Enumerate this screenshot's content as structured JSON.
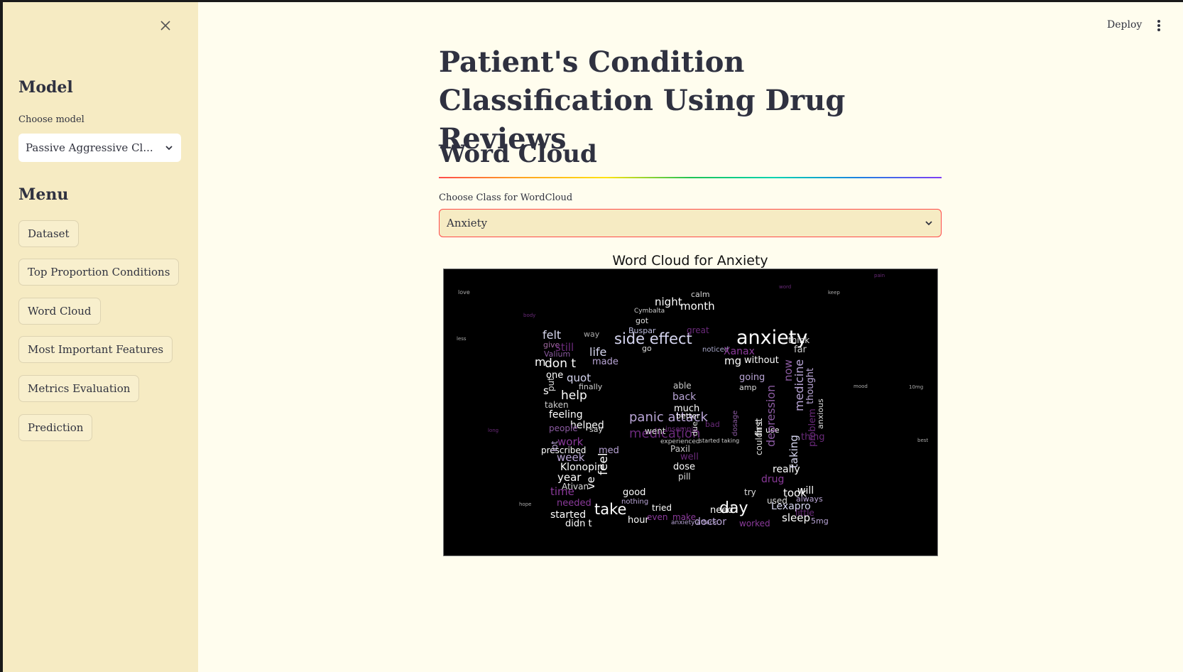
{
  "sidebar": {
    "close_icon": "close-icon",
    "model_heading": "Model",
    "model_label": "Choose model",
    "model_value": "Passive Aggressive Cl...",
    "menu_heading": "Menu",
    "menu_items": [
      "Dataset",
      "Top Proportion Conditions",
      "Word Cloud",
      "Most Important Features",
      "Metrics Evaluation",
      "Prediction"
    ]
  },
  "topbar": {
    "deploy_label": "Deploy",
    "menu_icon": "kebab-menu-icon"
  },
  "main": {
    "title": "Patient's Condition Classification Using Drug Reviews",
    "section_title": "Word Cloud",
    "class_label": "Choose Class for WordCloud",
    "class_value": "Anxiety",
    "wordcloud_title": "Word Cloud for Anxiety"
  },
  "wordcloud": {
    "words": [
      {
        "text": "anxiety",
        "size": 27,
        "color": "#ffffff"
      },
      {
        "text": "side effect",
        "size": 21,
        "color": "#d6d6f0"
      },
      {
        "text": "panic attack",
        "size": 18,
        "color": "#b9a5d6"
      },
      {
        "text": "medication",
        "size": 18,
        "color": "#6a2a7a"
      },
      {
        "text": "take",
        "size": 21,
        "color": "#ffffff"
      },
      {
        "text": "day",
        "size": 22,
        "color": "#ffffff"
      },
      {
        "text": "night",
        "size": 15,
        "color": "#ffffff"
      },
      {
        "text": "month",
        "size": 15,
        "color": "#ffffff"
      },
      {
        "text": "calm",
        "size": 11,
        "color": "#d8d8d8"
      },
      {
        "text": "Cymbalta",
        "size": 9,
        "color": "#cccccc"
      },
      {
        "text": "got",
        "size": 11,
        "color": "#dddddd"
      },
      {
        "text": "Buspar",
        "size": 11,
        "color": "#bbbbdd"
      },
      {
        "text": "great",
        "size": 12,
        "color": "#6a2a7a"
      },
      {
        "text": "felt",
        "size": 16,
        "color": "#d8d8ee"
      },
      {
        "text": "way",
        "size": 11,
        "color": "#aaaaaa"
      },
      {
        "text": "give",
        "size": 11,
        "color": "#a06aa0"
      },
      {
        "text": "still",
        "size": 15,
        "color": "#6a2a7a"
      },
      {
        "text": "life",
        "size": 16,
        "color": "#d6d6f0"
      },
      {
        "text": "go",
        "size": 11,
        "color": "#dddddd"
      },
      {
        "text": "noticed",
        "size": 10,
        "color": "#aaaacc"
      },
      {
        "text": "Xanax",
        "size": 14,
        "color": "#8a3a9a"
      },
      {
        "text": "think",
        "size": 12,
        "color": "#dddddd"
      },
      {
        "text": "far",
        "size": 13,
        "color": "#cccccc"
      },
      {
        "text": "Valium",
        "size": 11,
        "color": "#8a5aa0"
      },
      {
        "text": "m",
        "size": 16,
        "color": "#ffffff"
      },
      {
        "text": "don t",
        "size": 17,
        "color": "#ffffff"
      },
      {
        "text": "made",
        "size": 13,
        "color": "#b9a5d6"
      },
      {
        "text": "mg",
        "size": 15,
        "color": "#ffffff"
      },
      {
        "text": "without",
        "size": 13,
        "color": "#ffffff"
      },
      {
        "text": "one",
        "size": 13,
        "color": "#ffffff"
      },
      {
        "text": "quot",
        "size": 15,
        "color": "#d6d6f0"
      },
      {
        "text": "finally",
        "size": 11,
        "color": "#cccccc"
      },
      {
        "text": "going",
        "size": 13,
        "color": "#b9a5d6"
      },
      {
        "text": "amp",
        "size": 11,
        "color": "#dddddd"
      },
      {
        "text": "able",
        "size": 12,
        "color": "#cccccc"
      },
      {
        "text": "back",
        "size": 14,
        "color": "#b9a5d6"
      },
      {
        "text": "s",
        "size": 15,
        "color": "#ffffff"
      },
      {
        "text": "help",
        "size": 17,
        "color": "#ffffff"
      },
      {
        "text": "much",
        "size": 13,
        "color": "#ffffff"
      },
      {
        "text": "taken",
        "size": 12,
        "color": "#cccccc"
      },
      {
        "text": "feeling",
        "size": 14,
        "color": "#ffffff"
      },
      {
        "text": "better",
        "size": 11,
        "color": "#ffffff"
      },
      {
        "text": "helped",
        "size": 14,
        "color": "#ffffff"
      },
      {
        "text": "people",
        "size": 12,
        "color": "#8a5aa0"
      },
      {
        "text": "say",
        "size": 11,
        "color": "#dddddd"
      },
      {
        "text": "went",
        "size": 12,
        "color": "#dddddd"
      },
      {
        "text": "work",
        "size": 15,
        "color": "#8a3a9a"
      },
      {
        "text": "prescribed",
        "size": 12,
        "color": "#ffffff"
      },
      {
        "text": "med",
        "size": 13,
        "color": "#b9a5d6"
      },
      {
        "text": "Paxil",
        "size": 12,
        "color": "#cccccc"
      },
      {
        "text": "week",
        "size": 15,
        "color": "#b9a5d6"
      },
      {
        "text": "well",
        "size": 13,
        "color": "#6a2a7a"
      },
      {
        "text": "Klonopin",
        "size": 14,
        "color": "#ffffff"
      },
      {
        "text": "dose",
        "size": 13,
        "color": "#ffffff"
      },
      {
        "text": "pill",
        "size": 12,
        "color": "#dddddd"
      },
      {
        "text": "really",
        "size": 14,
        "color": "#ffffff"
      },
      {
        "text": "year",
        "size": 15,
        "color": "#ffffff"
      },
      {
        "text": "Ativan",
        "size": 12,
        "color": "#dddddd"
      },
      {
        "text": "time",
        "size": 15,
        "color": "#8a3a9a"
      },
      {
        "text": "good",
        "size": 13,
        "color": "#ffffff"
      },
      {
        "text": "nothing",
        "size": 10,
        "color": "#b9a5d6"
      },
      {
        "text": "needed",
        "size": 13,
        "color": "#8a3a9a"
      },
      {
        "text": "tried",
        "size": 12,
        "color": "#ffffff"
      },
      {
        "text": "try",
        "size": 12,
        "color": "#dddddd"
      },
      {
        "text": "took",
        "size": 15,
        "color": "#ffffff"
      },
      {
        "text": "will",
        "size": 14,
        "color": "#ffffff"
      },
      {
        "text": "used",
        "size": 12,
        "color": "#dddddd"
      },
      {
        "text": "always",
        "size": 11,
        "color": "#b9a5d6"
      },
      {
        "text": "Lexapro",
        "size": 14,
        "color": "#d6d6f0"
      },
      {
        "text": "little",
        "size": 12,
        "color": "#6a2a7a"
      },
      {
        "text": "started",
        "size": 14,
        "color": "#ffffff"
      },
      {
        "text": "didn t",
        "size": 13,
        "color": "#ffffff"
      },
      {
        "text": "hour",
        "size": 13,
        "color": "#ffffff"
      },
      {
        "text": "even",
        "size": 12,
        "color": "#8a3a9a"
      },
      {
        "text": "make",
        "size": 12,
        "color": "#8a3a9a"
      },
      {
        "text": "need",
        "size": 13,
        "color": "#ffffff"
      },
      {
        "text": "doctor",
        "size": 14,
        "color": "#b9a5d6"
      },
      {
        "text": "worked",
        "size": 12,
        "color": "#8a3a9a"
      },
      {
        "text": "sleep",
        "size": 15,
        "color": "#ffffff"
      },
      {
        "text": "5mg",
        "size": 11,
        "color": "#b9a5d6"
      },
      {
        "text": "drug",
        "size": 14,
        "color": "#8a3a9a"
      },
      {
        "text": "thing",
        "size": 13,
        "color": "#6a2a7a"
      },
      {
        "text": "use",
        "size": 11,
        "color": "#ffffff"
      },
      {
        "text": "anxiety attack",
        "size": 9,
        "color": "#b9a5d6"
      },
      {
        "text": "medicine",
        "size": 16,
        "color": "#b9a5d6"
      },
      {
        "text": "depression",
        "size": 16,
        "color": "#8a5aa0"
      },
      {
        "text": "taking",
        "size": 15,
        "color": "#d6d6f0"
      },
      {
        "text": "first",
        "size": 13,
        "color": "#ffffff"
      },
      {
        "text": "couldn t",
        "size": 12,
        "color": "#dddddd"
      },
      {
        "text": "thought",
        "size": 13,
        "color": "#b9a5d6"
      },
      {
        "text": "now",
        "size": 15,
        "color": "#8a5aa0"
      },
      {
        "text": "problem",
        "size": 13,
        "color": "#6a2a7a"
      },
      {
        "text": "anxious",
        "size": 11,
        "color": "#dddddd"
      },
      {
        "text": "feel",
        "size": 17,
        "color": "#ffffff"
      },
      {
        "text": "put",
        "size": 12,
        "color": "#dddddd"
      },
      {
        "text": "ve",
        "size": 15,
        "color": "#ffffff"
      },
      {
        "text": "lot",
        "size": 12,
        "color": "#b9a5d6"
      },
      {
        "text": "experienced",
        "size": 9,
        "color": "#cccccc"
      },
      {
        "text": "started taking",
        "size": 8,
        "color": "#cccccc"
      },
      {
        "text": "insomnia",
        "size": 10,
        "color": "#6a2a7a"
      },
      {
        "text": "bad",
        "size": 11,
        "color": "#6a2a7a"
      },
      {
        "text": "due",
        "size": 11,
        "color": "#dddddd"
      },
      {
        "text": "dosage",
        "size": 10,
        "color": "#8a5aa0"
      },
      {
        "text": "love",
        "size": 8,
        "color": "#aaaaaa"
      },
      {
        "text": "less",
        "size": 7,
        "color": "#aaaaaa"
      },
      {
        "text": "long",
        "size": 7,
        "color": "#6a2a7a"
      },
      {
        "text": "hope",
        "size": 7,
        "color": "#aaaaaa"
      },
      {
        "text": "mood",
        "size": 7,
        "color": "#aaaaaa"
      },
      {
        "text": "best",
        "size": 7,
        "color": "#aaaaaa"
      },
      {
        "text": "keep",
        "size": 7,
        "color": "#aaaaaa"
      },
      {
        "text": "pain",
        "size": 7,
        "color": "#6a2a7a"
      },
      {
        "text": "10mg",
        "size": 7,
        "color": "#aaaaaa"
      },
      {
        "text": "body",
        "size": 7,
        "color": "#6a2a7a"
      },
      {
        "text": "word",
        "size": 7,
        "color": "#6a2a7a"
      }
    ]
  }
}
